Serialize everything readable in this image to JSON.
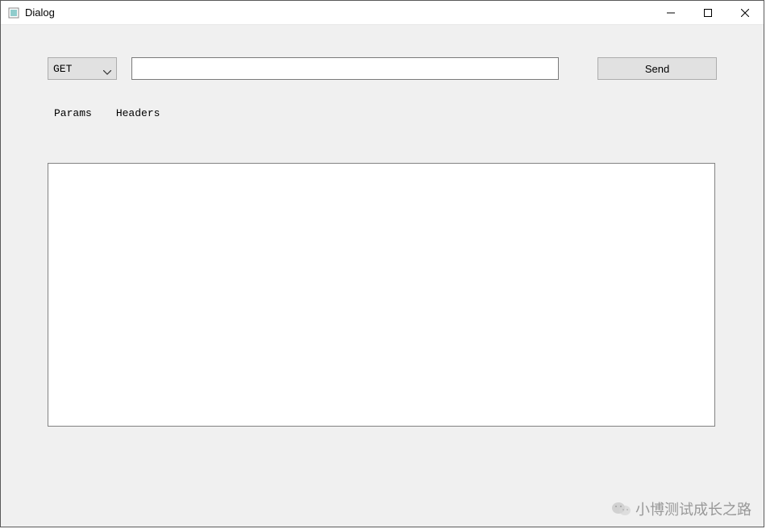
{
  "window": {
    "title": "Dialog"
  },
  "toolbar": {
    "method_value": "GET",
    "url_value": "",
    "send_label": "Send"
  },
  "tabs": {
    "params_label": "Params",
    "headers_label": "Headers"
  },
  "watermark": {
    "text": "小博测试成长之路"
  }
}
